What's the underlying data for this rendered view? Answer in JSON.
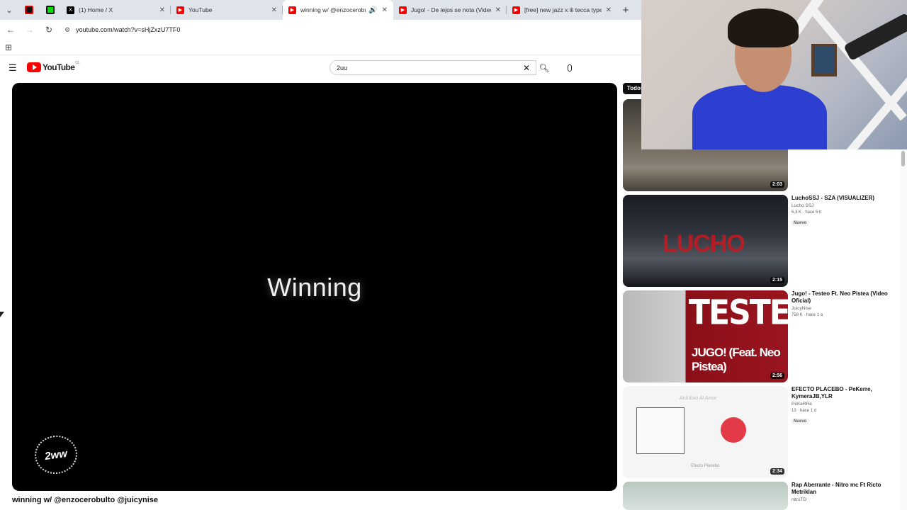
{
  "browser": {
    "tabs": [
      {
        "title": "(1) Home / X",
        "favicon": "x-icon",
        "color": "#000000"
      },
      {
        "title": "YouTube",
        "favicon": "youtube-icon",
        "color": "#ff0000"
      },
      {
        "title": "winning w/ @enzocerobulto",
        "favicon": "youtube-icon",
        "color": "#ff0000"
      },
      {
        "title": "Jugo! - De lejos se nota (Video",
        "favicon": "youtube-icon",
        "color": "#ff0000"
      },
      {
        "title": "[free] new jazz x lil tecca type b",
        "favicon": "youtube-icon",
        "color": "#ff0000"
      }
    ],
    "url": "youtube.com/watch?v=sHjZxzU7TF0"
  },
  "youtube": {
    "logo_text": "YouTube",
    "country": "CL",
    "search_value": "2uu",
    "video": {
      "overlay_text": "Winning",
      "badge_text": "2ww",
      "title": "winning w/ @enzocerobulto @juicynise"
    },
    "chip_label": "Todos",
    "recommendations": [
      {
        "title": "",
        "channel": "",
        "stats": "",
        "duration": "2:03",
        "new": ""
      },
      {
        "title": "LuchoSSJ - SZA (VISUALIZER)",
        "channel": "Lucho SSJ",
        "stats": "5,3 K · hace 5 h",
        "duration": "2:15",
        "new": "Nuevo",
        "thumb_text": "LUCHO"
      },
      {
        "title": "Jugo! - Testeo Ft. Neo Pistea (Video Oficial)",
        "channel": "JuicyNise",
        "stats": "758 K · hace 1 a",
        "duration": "2:56",
        "new": "",
        "thumb_text": "TESTEO",
        "thumb_sub": "JUGO! (Feat. Neo Pistea)"
      },
      {
        "title": "EFECTO PLACEBO - PeKerre, KymeraJB,YLR",
        "channel": "PeKeRRe",
        "stats": "13 · hace 1 d",
        "duration": "2:34",
        "new": "Nuevo",
        "thumb_text": "Efecto Placebo",
        "thumb_top": "Antídoto Al Amor"
      },
      {
        "title": "Rap Aberrante - Nitro mc Ft Ricto Metriklan",
        "channel": "nitroTD",
        "stats": "",
        "duration": "",
        "new": ""
      }
    ]
  }
}
